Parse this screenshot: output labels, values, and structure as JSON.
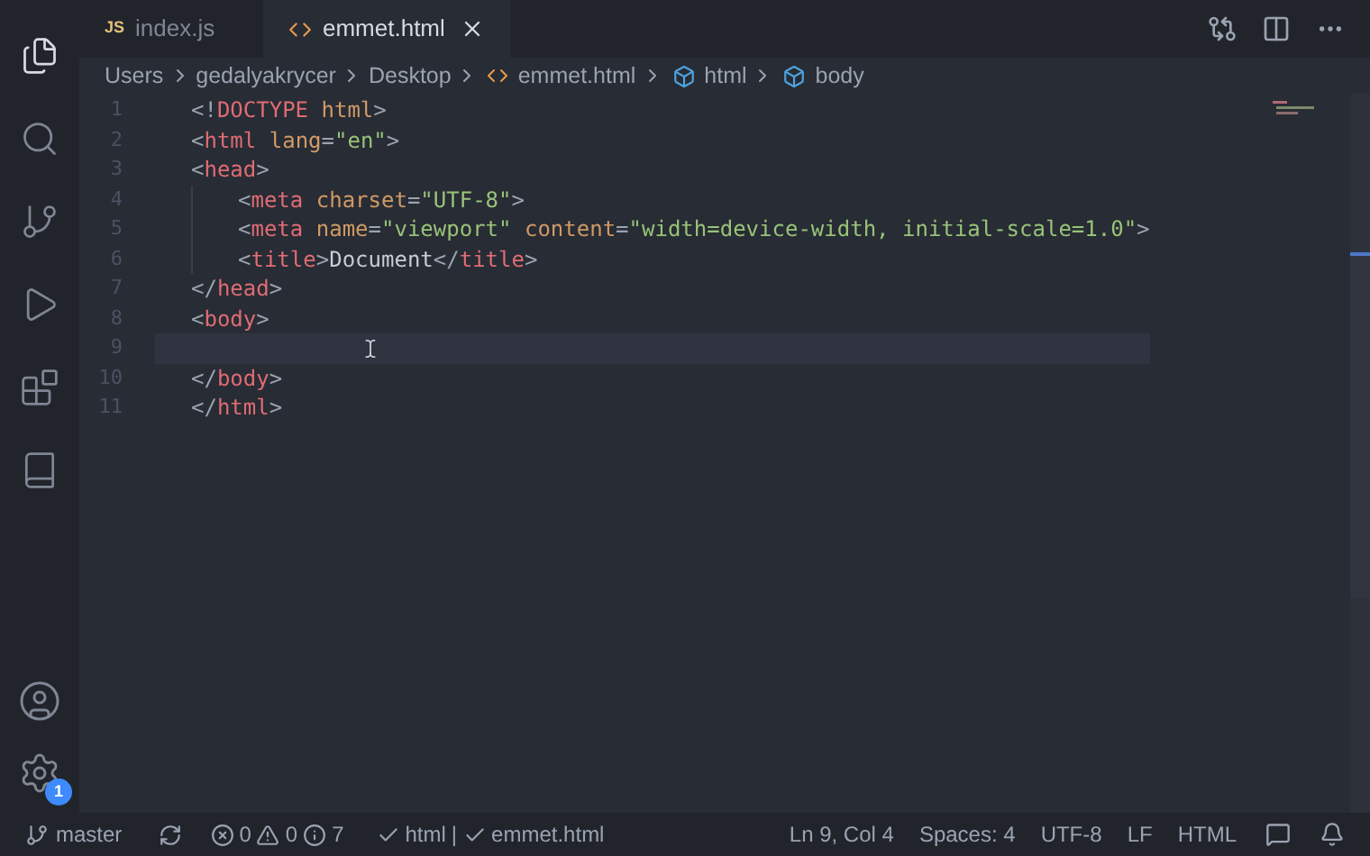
{
  "activity_bar": {
    "items": [
      {
        "kind": "files",
        "selected": true
      },
      {
        "kind": "search",
        "selected": false
      },
      {
        "kind": "source-control",
        "selected": false
      },
      {
        "kind": "run",
        "selected": false
      },
      {
        "kind": "extensions",
        "selected": false
      },
      {
        "kind": "book",
        "selected": false
      }
    ],
    "account": {
      "kind": "account"
    },
    "settings": {
      "badge": "1"
    }
  },
  "tabs": [
    {
      "icon_text": "JS",
      "label": "index.js",
      "selected": false,
      "closable": false
    },
    {
      "label": "emmet.html",
      "selected": true,
      "closable": true
    }
  ],
  "breadcrumbs": [
    {
      "label": "Users",
      "kind": "folder"
    },
    {
      "label": "gedalyakrycer",
      "kind": "folder"
    },
    {
      "label": "Desktop",
      "kind": "folder"
    },
    {
      "label": "emmet.html",
      "kind": "file"
    },
    {
      "label": "html",
      "kind": "element"
    },
    {
      "label": "body",
      "kind": "element"
    }
  ],
  "code": [
    {
      "number": "1",
      "current": false,
      "tokens": [
        {
          "kind": "punct",
          "text": "<!"
        },
        {
          "kind": "tag",
          "text": "DOCTYPE"
        },
        {
          "kind": "attr",
          "text": " html"
        },
        {
          "kind": "punct",
          "text": ">"
        }
      ]
    },
    {
      "number": "2",
      "current": false,
      "tokens": [
        {
          "kind": "punct",
          "text": "<"
        },
        {
          "kind": "tag",
          "text": "html"
        },
        {
          "kind": "attr",
          "text": " lang"
        },
        {
          "kind": "punct",
          "text": "="
        },
        {
          "kind": "string",
          "text": "\"en\""
        },
        {
          "kind": "punct",
          "text": ">"
        }
      ]
    },
    {
      "number": "3",
      "current": false,
      "tokens": [
        {
          "kind": "punct",
          "text": "<"
        },
        {
          "kind": "tag",
          "text": "head"
        },
        {
          "kind": "punct",
          "text": ">"
        }
      ],
      "children": [
        {
          "number": "4",
          "current": false,
          "tokens": [
            {
              "kind": "punct",
              "text": "<"
            },
            {
              "kind": "tag",
              "text": "meta"
            },
            {
              "kind": "attr",
              "text": " charset"
            },
            {
              "kind": "punct",
              "text": "="
            },
            {
              "kind": "string",
              "text": "\"UTF-8\""
            },
            {
              "kind": "punct",
              "text": ">"
            }
          ]
        },
        {
          "number": "5",
          "current": false,
          "tokens": [
            {
              "kind": "punct",
              "text": "<"
            },
            {
              "kind": "tag",
              "text": "meta"
            },
            {
              "kind": "attr",
              "text": " name"
            },
            {
              "kind": "punct",
              "text": "="
            },
            {
              "kind": "string",
              "text": "\"viewport\""
            },
            {
              "kind": "attr",
              "text": " content"
            },
            {
              "kind": "punct",
              "text": "="
            },
            {
              "kind": "string",
              "text": "\"width=device-width, initial-scale=1.0\""
            },
            {
              "kind": "punct",
              "text": ">"
            }
          ]
        },
        {
          "number": "6",
          "current": false,
          "tokens": [
            {
              "kind": "punct",
              "text": "<"
            },
            {
              "kind": "tag",
              "text": "title"
            },
            {
              "kind": "punct",
              "text": ">"
            },
            {
              "kind": "text",
              "text": "Document"
            },
            {
              "kind": "punct",
              "text": "</"
            },
            {
              "kind": "tag",
              "text": "title"
            },
            {
              "kind": "punct",
              "text": ">"
            }
          ]
        }
      ]
    },
    {
      "number": "7",
      "current": false,
      "tokens": [
        {
          "kind": "punct",
          "text": "</"
        },
        {
          "kind": "tag",
          "text": "head"
        },
        {
          "kind": "punct",
          "text": ">"
        }
      ]
    },
    {
      "number": "8",
      "current": false,
      "tokens": [
        {
          "kind": "punct",
          "text": "<"
        },
        {
          "kind": "tag",
          "text": "body"
        },
        {
          "kind": "punct",
          "text": ">"
        }
      ]
    },
    {
      "number": "9",
      "current": true
    },
    {
      "number": "10",
      "current": false,
      "tokens": [
        {
          "kind": "punct",
          "text": "</"
        },
        {
          "kind": "tag",
          "text": "body"
        },
        {
          "kind": "punct",
          "text": ">"
        }
      ]
    },
    {
      "number": "11",
      "current": false,
      "tokens": [
        {
          "kind": "punct",
          "text": "</"
        },
        {
          "kind": "tag",
          "text": "html"
        },
        {
          "kind": "punct",
          "text": ">"
        }
      ]
    }
  ],
  "status_bar": {
    "branch": "master",
    "errors": "0",
    "warnings": "0",
    "infos": "7",
    "checks": [
      "html",
      "emmet.html"
    ],
    "separator": "|",
    "right": [
      "Ln 9, Col 4",
      "Spaces: 4",
      "UTF-8",
      "LF",
      "HTML"
    ]
  }
}
